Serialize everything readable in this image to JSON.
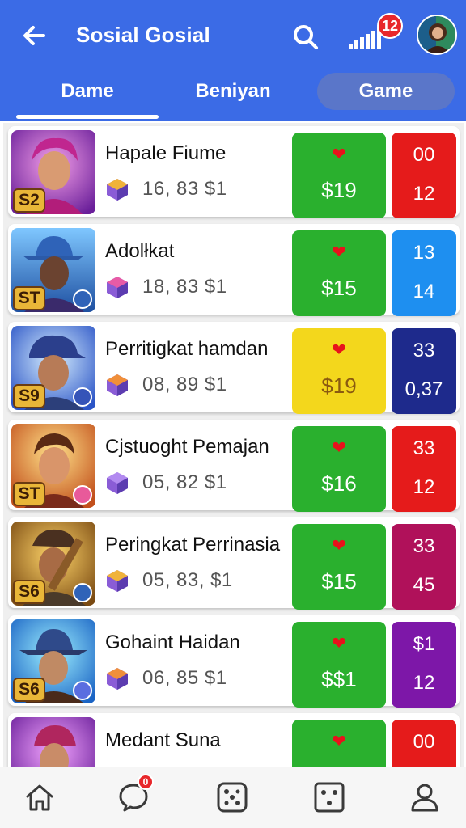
{
  "header": {
    "title": "Sosial Gosial",
    "notification_count": "12",
    "icons": [
      "back-arrow-icon",
      "search-icon",
      "signal-icon",
      "avatar"
    ]
  },
  "tabs": [
    {
      "label": "Dame",
      "active": true
    },
    {
      "label": "Beniyan",
      "active": false
    },
    {
      "label": "Game",
      "active": false
    }
  ],
  "rows": [
    {
      "name": "Hapale Fiume",
      "level": "S2",
      "stats": "16, 83  $1",
      "price": "$19",
      "price_color": "#2ab02e",
      "score_top": "00",
      "score_bottom": "12",
      "score_color": "#e51b1b"
    },
    {
      "name": "Adolłkat",
      "level": "ST",
      "stats": "18, 83  $1",
      "price": "$15",
      "price_color": "#2ab02e",
      "score_top": "13",
      "score_bottom": "14",
      "score_color": "#1e8ff0"
    },
    {
      "name": "Perritigkat hamdan",
      "level": "S9",
      "stats": "08, 89  $1",
      "price": "$19",
      "price_color": "#f3d71c",
      "score_top": "33",
      "score_bottom": "0,37",
      "score_color": "#1e2a8c"
    },
    {
      "name": "Cjstuoght Pemajan",
      "level": "ST",
      "stats": "05, 82  $1",
      "price": "$16",
      "price_color": "#2ab02e",
      "score_top": "33",
      "score_bottom": "12",
      "score_color": "#e51b1b"
    },
    {
      "name": "Peringkat Perrinasia",
      "level": "S6",
      "stats": "05, 83, $1",
      "price": "$15",
      "price_color": "#2ab02e",
      "score_top": "33",
      "score_bottom": "45",
      "score_color": "#b0115a"
    },
    {
      "name": "Gohaint Haidan",
      "level": "S6",
      "stats": "06, 85  $1",
      "price": "$$1",
      "price_color": "#2ab02e",
      "score_top": "$1",
      "score_bottom": "12",
      "score_color": "#7d17a8"
    },
    {
      "name": "Medant Suna",
      "level": "",
      "stats": "",
      "price": "",
      "price_color": "#2ab02e",
      "score_top": "00",
      "score_bottom": "",
      "score_color": "#e51b1b"
    }
  ],
  "bottom_nav": {
    "items": [
      "home-icon",
      "chat-icon",
      "dice-icon",
      "dice-square-icon",
      "profile-icon"
    ],
    "chat_badge": "0"
  }
}
